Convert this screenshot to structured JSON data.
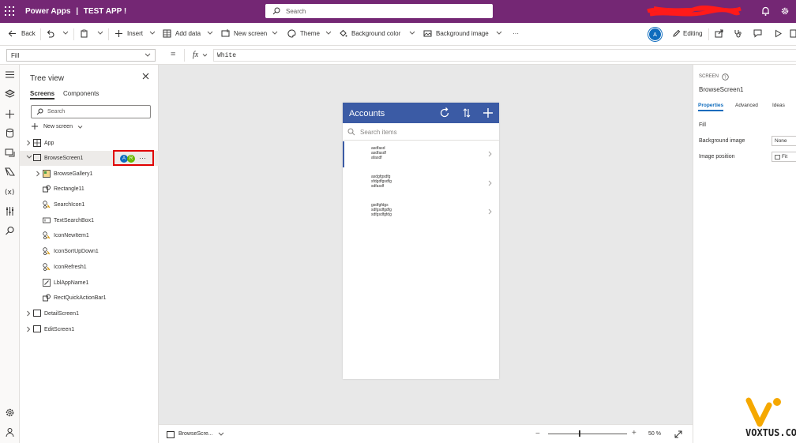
{
  "app": {
    "name": "Power Apps",
    "separator": "|",
    "project": "TEST APP !"
  },
  "search": {
    "placeholder": "Search"
  },
  "toolbar": {
    "back": "Back",
    "insert": "Insert",
    "add_data": "Add data",
    "new_screen": "New screen",
    "theme": "Theme",
    "background_color": "Background color",
    "background_image": "Background image",
    "more": "···",
    "avatar": "A",
    "editing": "Editing"
  },
  "formula_bar": {
    "property": "Fill",
    "equals": "=",
    "fx": "fx",
    "formula": "White"
  },
  "tree": {
    "title": "Tree view",
    "tabs": [
      "Screens",
      "Components"
    ],
    "search_placeholder": "Search",
    "new_screen": "New screen",
    "items": [
      {
        "label": "App",
        "level": 0
      },
      {
        "label": "BrowseScreen1",
        "level": 0
      },
      {
        "label": "BrowseGallery1",
        "level": 1
      },
      {
        "label": "Rectangle11",
        "level": 1
      },
      {
        "label": "SearchIcon1",
        "level": 1
      },
      {
        "label": "TextSearchBox1",
        "level": 1
      },
      {
        "label": "IconNewItem1",
        "level": 1
      },
      {
        "label": "IconSortUpDown1",
        "level": 1
      },
      {
        "label": "IconRefresh1",
        "level": 1
      },
      {
        "label": "LblAppName1",
        "level": 1
      },
      {
        "label": "RectQuickActionBar1",
        "level": 1
      },
      {
        "label": "DetailScreen1",
        "level": 0
      },
      {
        "label": "EditScreen1",
        "level": 0
      }
    ],
    "row_badges": [
      "A",
      "R"
    ],
    "row_more": "···"
  },
  "phone": {
    "title": "Accounts",
    "search_placeholder": "Search items",
    "items": [
      [
        "asdfasd",
        "asdfasdf",
        "afasdf"
      ],
      [
        "asdgfgsdfg",
        "sfdgdfgsdfg",
        "sdfasdf"
      ],
      [
        "gsdfgfdgs",
        "sdfgsdfgdfg",
        "sdfgsdfgfdg"
      ]
    ]
  },
  "statusbar": {
    "screen": "BrowseScre...",
    "zoom_value": "50",
    "zoom_unit": "%",
    "zoom_level": 0.4
  },
  "properties": {
    "caption": "SCREEN",
    "name": "BrowseScreen1",
    "tabs": [
      "Properties",
      "Advanced",
      "Ideas"
    ],
    "rows": [
      {
        "label": "Fill",
        "value": ""
      },
      {
        "label": "Background image",
        "value": "None"
      },
      {
        "label": "Image position",
        "value": "Fit"
      }
    ]
  },
  "watermark": "VOXTUS.COM",
  "colors": {
    "topbar": "#742774",
    "phone_header": "#3b5ba5",
    "accent": "#0f6cbd",
    "highlight_box": "#e00000"
  }
}
